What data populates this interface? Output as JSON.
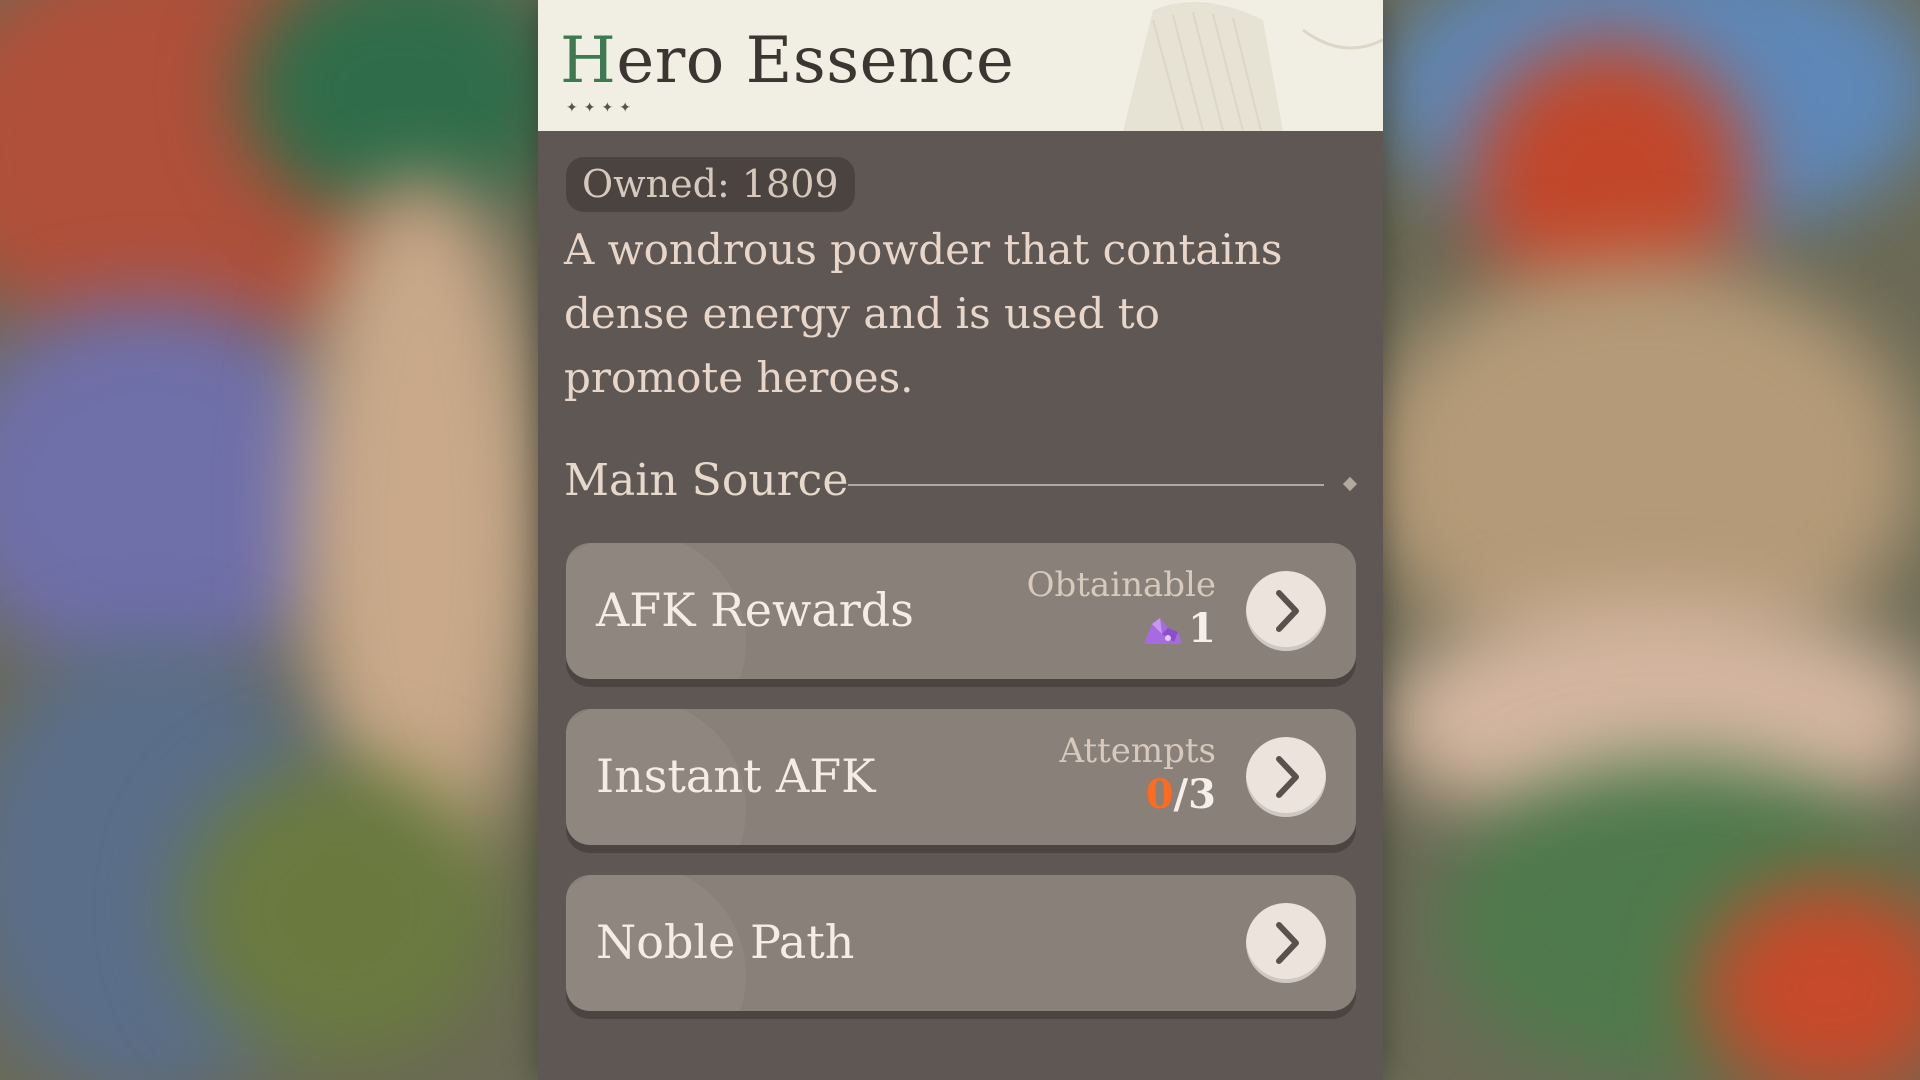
{
  "panel": {
    "title_first": "H",
    "title_rest": "ero Essence",
    "stars": "✦✦✦✦",
    "owned": "Owned: 1809",
    "description": "A wondrous powder that contains dense energy and is used to promote heroes.",
    "section_title": "Main Source"
  },
  "sources": [
    {
      "label": "AFK Rewards",
      "meta_label": "Obtainable",
      "meta_value": "1",
      "icon": "purple-crystal-icon",
      "action_icon": "chevron-right-icon"
    },
    {
      "label": "Instant AFK",
      "meta_label": "Attempts",
      "meta_value_used": "0",
      "meta_value_total": "/3",
      "action_icon": "chevron-right-icon"
    },
    {
      "label": "Noble Path",
      "action_icon": "chevron-right-icon"
    }
  ],
  "colors": {
    "panel_bg": "#5f5753",
    "header_bg": "#f1efe4",
    "source_card": "#898079",
    "accent_orange": "#ff6a1f",
    "title_accent_green": "#3e7a4f",
    "crystal_purple": "#a66be0"
  }
}
